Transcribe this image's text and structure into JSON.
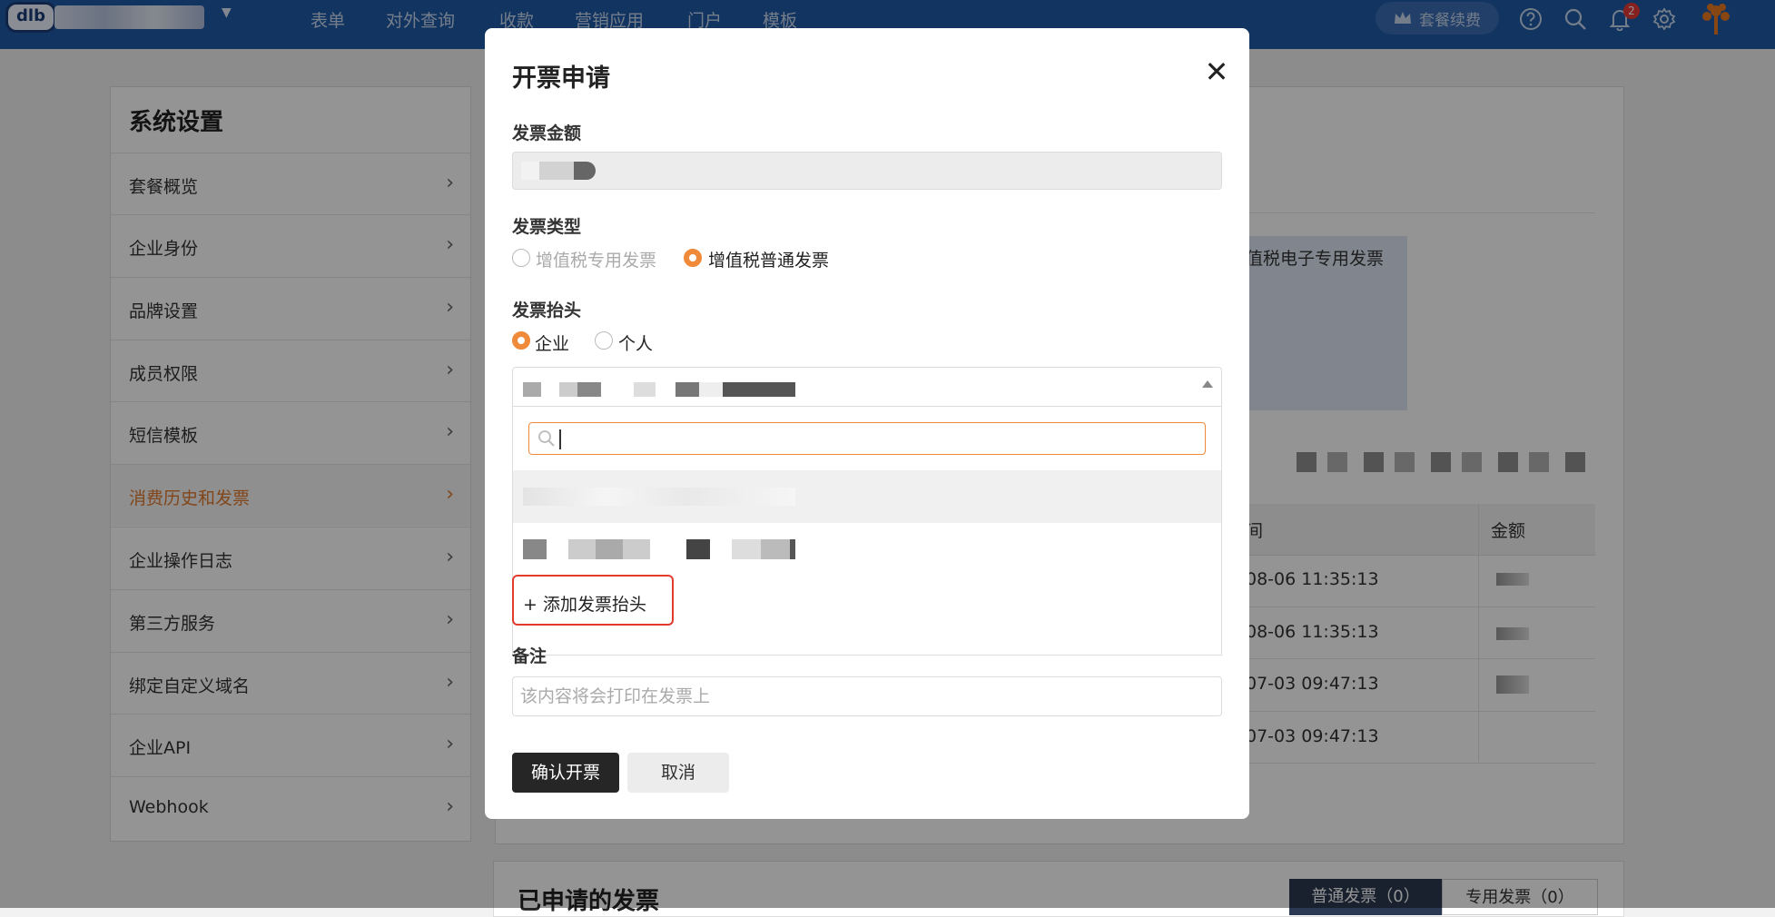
{
  "topbar": {
    "logo_text": "dlb",
    "nav": [
      "表单",
      "对外查询",
      "收款",
      "营销应用",
      "门户",
      "模板"
    ],
    "renew_label": "套餐续费",
    "notification_count": "2"
  },
  "settings": {
    "title": "系统设置",
    "items": [
      {
        "label": "套餐概览"
      },
      {
        "label": "企业身份"
      },
      {
        "label": "品牌设置"
      },
      {
        "label": "成员权限"
      },
      {
        "label": "短信模板"
      },
      {
        "label": "消费历史和发票",
        "active": true
      },
      {
        "label": "企业操作日志"
      },
      {
        "label": "第三方服务"
      },
      {
        "label": "绑定自定义域名"
      },
      {
        "label": "企业API"
      },
      {
        "label": "Webhook"
      }
    ]
  },
  "background": {
    "info_text": "值税电子专用发票",
    "table": {
      "col_time": "间",
      "col_amount": "金额",
      "rows": [
        {
          "time": "08-06 11:35:13"
        },
        {
          "time": "08-06 11:35:13"
        },
        {
          "time": "07-03 09:47:13"
        },
        {
          "time": "07-03 09:47:13"
        }
      ]
    },
    "applied_title": "已申请的发票",
    "tab_normal": "普通发票（0）",
    "tab_special": "专用发票（0）"
  },
  "modal": {
    "title": "开票申请",
    "close_symbol": "✕",
    "amount_label": "发票金额",
    "type_label": "发票类型",
    "type_options": [
      {
        "label": "增值税专用发票",
        "selected": false
      },
      {
        "label": "增值税普通发票",
        "selected": true
      }
    ],
    "header_label": "发票抬头",
    "header_options": [
      {
        "label": "企业",
        "selected": true
      },
      {
        "label": "个人",
        "selected": false
      }
    ],
    "add_header_label": "+ 添加发票抬头",
    "note_label": "备注",
    "note_placeholder": "该内容将会打印在发票上",
    "confirm_label": "确认开票",
    "cancel_label": "取消"
  },
  "colors": {
    "accent": "#ef8a3a",
    "nav_bg": "#1e5aa8",
    "highlight_border": "#e23b2e",
    "confirm_bg": "#262626"
  }
}
